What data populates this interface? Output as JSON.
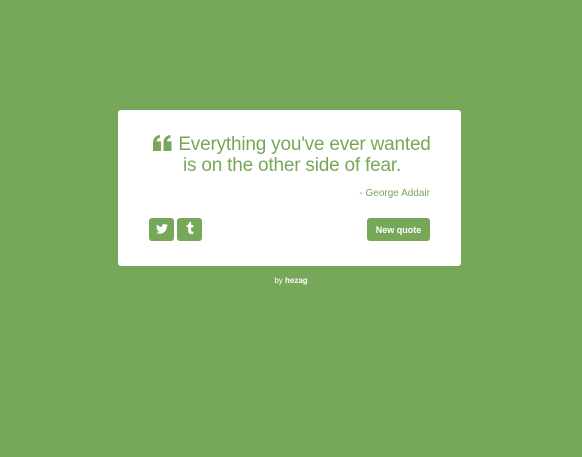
{
  "quote": {
    "text": "Everything you've ever wanted is on the other side of fear.",
    "author": "- George Addair",
    "icon": "quote-left-icon"
  },
  "actions": {
    "twitter_icon": "twitter-icon",
    "tumblr_icon": "tumblr-icon",
    "new_quote_label": "New quote"
  },
  "footer": {
    "by_label": "by",
    "author_link": "hezag"
  },
  "colors": {
    "background": "#77a759",
    "card": "#ffffff",
    "accent": "#77a759"
  }
}
